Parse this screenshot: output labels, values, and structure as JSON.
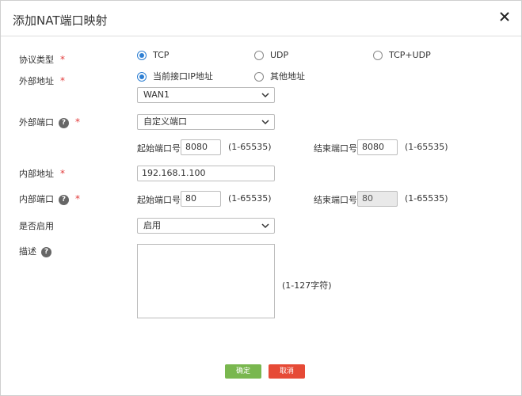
{
  "dialog": {
    "title": "添加NAT端口映射",
    "close_icon": "close-icon"
  },
  "protocol": {
    "label": "协议类型",
    "required": "*",
    "options": [
      "TCP",
      "UDP",
      "TCP+UDP"
    ],
    "selected": "TCP"
  },
  "external_address": {
    "label": "外部地址",
    "required": "*",
    "options": [
      "当前接口IP地址",
      "其他地址"
    ],
    "selected": "当前接口IP地址",
    "interface_value": "WAN1"
  },
  "external_port": {
    "label": "外部端口",
    "help_icon": "?",
    "required": "*",
    "mode_value": "自定义端口",
    "start_label": "起始端口号",
    "start_value": "8080",
    "start_range": "(1-65535)",
    "end_label": "结束端口号",
    "end_value": "8080",
    "end_range": "(1-65535)"
  },
  "internal_address": {
    "label": "内部地址",
    "required": "*",
    "value": "192.168.1.100"
  },
  "internal_port": {
    "label": "内部端口",
    "help_icon": "?",
    "required": "*",
    "start_label": "起始端口号",
    "start_value": "80",
    "start_range": "(1-65535)",
    "end_label": "结束端口号",
    "end_value": "80",
    "end_range": "(1-65535)"
  },
  "enable": {
    "label": "是否启用",
    "value": "启用"
  },
  "description": {
    "label": "描述",
    "help_icon": "?",
    "hint": "(1-127字符)"
  },
  "buttons": {
    "confirm": "确定",
    "cancel": "取消"
  },
  "colors": {
    "accent": "#2d7fd3",
    "required": "#e23b3b",
    "confirm": "#79b74f",
    "cancel": "#e64a36"
  }
}
